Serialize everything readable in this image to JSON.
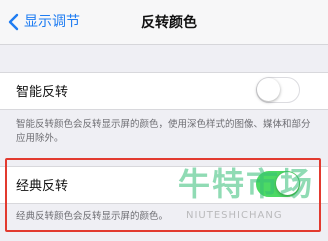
{
  "nav": {
    "back_label": "显示调节",
    "title": "反转颜色"
  },
  "smart_invert": {
    "label": "智能反转",
    "enabled": false,
    "description": "智能反转颜色会反转显示屏的颜色，使用深色样式的图像、媒体和部分应用除外。"
  },
  "classic_invert": {
    "label": "经典反转",
    "enabled": true,
    "description": "经典反转颜色会反转显示屏的颜色。"
  },
  "watermark": {
    "text": "牛特市场",
    "subtext": "NIUTESHICHANG"
  },
  "colors": {
    "accent": "#1e7cf2",
    "toggle_on": "#4cd964",
    "highlight": "#e23a2f",
    "background": "#efeff4"
  }
}
